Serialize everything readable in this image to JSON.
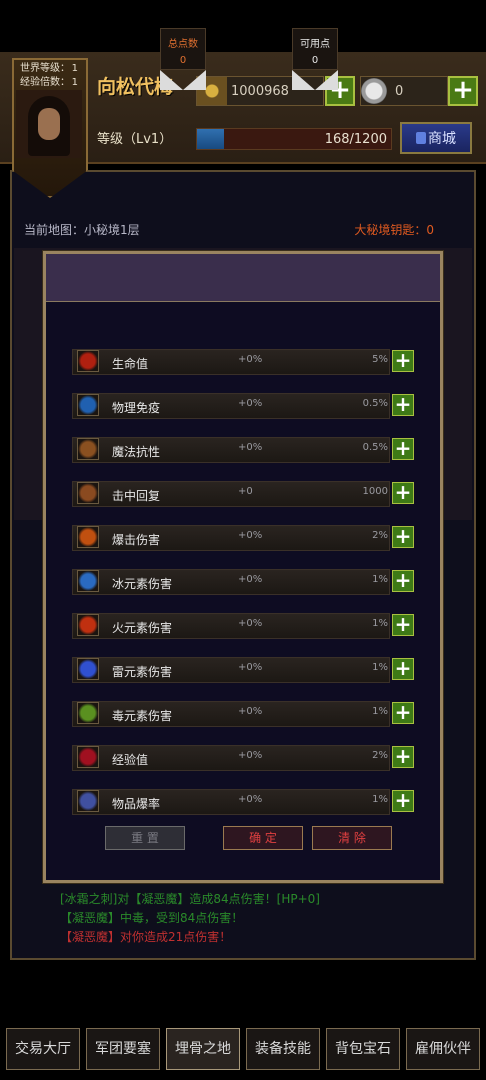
{
  "player": {
    "world_level_label": "世界等级：",
    "world_level_value": "1",
    "exp_multiplier_label": "经验倍数：",
    "exp_multiplier_value": "1",
    "name": "向松代梅",
    "level_label": "等级（Lv1）",
    "gold": "1000968",
    "coins": "0",
    "exp_text": "168/1200",
    "exp_progress": 0.14,
    "shop_label": "商城"
  },
  "map": {
    "current_map": "当前地图：小秘境1层",
    "keys": "大秘境钥匙：0"
  },
  "modal": {
    "total_points_label": "总点数",
    "total_points_value": "0",
    "available_points_label": "可用点",
    "available_points_value": "0",
    "attributes": [
      {
        "name": "生命值",
        "bonus": "+0%",
        "step": "5%",
        "icon": "heart-icon",
        "color": "#b02010"
      },
      {
        "name": "物理免疫",
        "bonus": "+0%",
        "step": "0.5%",
        "icon": "shield-figure-icon",
        "color": "#2060b0"
      },
      {
        "name": "魔法抗性",
        "bonus": "+0%",
        "step": "0.5%",
        "icon": "magic-resist-icon",
        "color": "#8a5020"
      },
      {
        "name": "击中回复",
        "bonus": "+0",
        "step": "1000",
        "icon": "fist-icon",
        "color": "#8a4a20"
      },
      {
        "name": "爆击伤害",
        "bonus": "+0%",
        "step": "2%",
        "icon": "crit-icon",
        "color": "#c05010"
      },
      {
        "name": "冰元素伤害",
        "bonus": "+0%",
        "step": "1%",
        "icon": "ice-icon",
        "color": "#2a6ac0"
      },
      {
        "name": "火元素伤害",
        "bonus": "+0%",
        "step": "1%",
        "icon": "fire-icon",
        "color": "#c03010"
      },
      {
        "name": "雷元素伤害",
        "bonus": "+0%",
        "step": "1%",
        "icon": "lightning-icon",
        "color": "#3050d0"
      },
      {
        "name": "毒元素伤害",
        "bonus": "+0%",
        "step": "1%",
        "icon": "poison-icon",
        "color": "#5a9020"
      },
      {
        "name": "经验值",
        "bonus": "+0%",
        "step": "2%",
        "icon": "exp-icon",
        "color": "#a01020"
      },
      {
        "name": "物品爆率",
        "bonus": "+0%",
        "step": "1%",
        "icon": "item-drop-icon",
        "color": "#4050a0"
      }
    ],
    "reset_label": "重 置",
    "confirm_label": "确 定",
    "clear_label": "清 除"
  },
  "log": [
    "[冰霜之刺]对【凝恶魔】造成84点伤害！[HP+0]",
    "【凝恶魔】中毒，受到84点伤害！",
    "【凝恶魔】对你造成21点伤害！"
  ],
  "nav": [
    "交易大厅",
    "军团要塞",
    "埋骨之地",
    "装备技能",
    "背包宝石",
    "雇佣伙伴"
  ],
  "nav_active": "埋骨之地"
}
